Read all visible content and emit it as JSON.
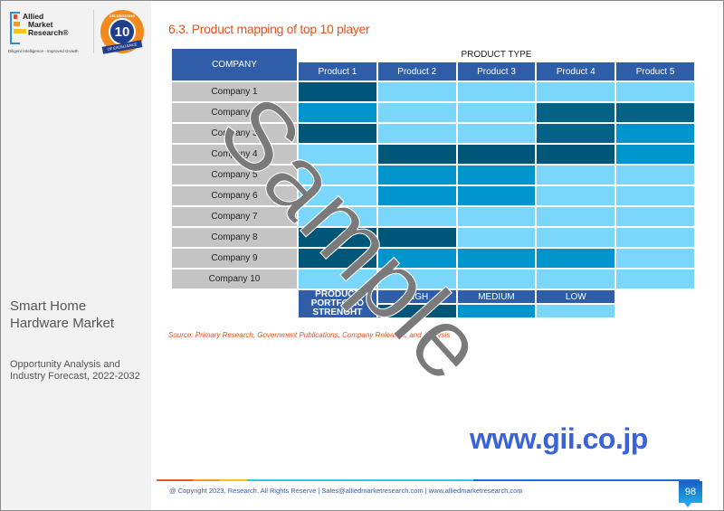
{
  "sidebar": {
    "logo": {
      "line1": "Allied",
      "line2": "Market",
      "line3": "Research®",
      "tagline": "Diligent Intelligence - Improved Growth"
    },
    "badge": {
      "top_text": "CELEBRATING",
      "number": "10",
      "years": "YEARS",
      "ribbon": "OF EXCELLENCE"
    },
    "market_title": "Smart Home Hardware Market",
    "market_subtitle": "Opportunity Analysis and Industry Forecast, 2022-2032"
  },
  "section_title": "6.3. Product mapping of top 10 player",
  "table": {
    "company_header": "COMPANY",
    "product_type_header": "PRODUCT TYPE",
    "products": [
      "Product 1",
      "Product 2",
      "Product 3",
      "Product 4",
      "Product 5"
    ],
    "colors": {
      "high": "#005677",
      "high_alt": "#046287",
      "medium": "#0096cd",
      "low": "#7ad7fb"
    },
    "rows": [
      {
        "company": "Company 1",
        "levels": [
          "high",
          "low",
          "low",
          "low",
          "low"
        ]
      },
      {
        "company": "Company 2",
        "levels": [
          "medium",
          "low",
          "low",
          "high_alt",
          "high_alt"
        ]
      },
      {
        "company": "Company 3",
        "levels": [
          "high",
          "low",
          "low",
          "high_alt",
          "medium"
        ]
      },
      {
        "company": "Company 4",
        "levels": [
          "low",
          "high",
          "high",
          "high",
          "medium"
        ]
      },
      {
        "company": "Company 5",
        "levels": [
          "low",
          "medium",
          "medium",
          "low",
          "low"
        ]
      },
      {
        "company": "Company 6",
        "levels": [
          "low",
          "medium",
          "medium",
          "low",
          "low"
        ]
      },
      {
        "company": "Company 7",
        "levels": [
          "low",
          "low",
          "low",
          "low",
          "low"
        ]
      },
      {
        "company": "Company 8",
        "levels": [
          "high",
          "high",
          "low",
          "low",
          "low"
        ]
      },
      {
        "company": "Company 9",
        "levels": [
          "high",
          "medium",
          "medium",
          "medium",
          "low"
        ]
      },
      {
        "company": "Company 10",
        "levels": [
          "low",
          "low",
          "low",
          "low",
          "low"
        ]
      }
    ],
    "legend": {
      "label": "PRODUCT PORTFOLIO STRENGHT",
      "keys": [
        {
          "label": "HIGH",
          "level": "high"
        },
        {
          "label": "MEDIUM",
          "level": "medium"
        },
        {
          "label": "LOW",
          "level": "low"
        }
      ]
    }
  },
  "source": "Source: Primary Research, Government Publications, Company Releases, and  Analysis",
  "watermark": "Sample",
  "gii_url": "www.gii.co.jp",
  "footer": {
    "text": "@ Copyright 2023, Research. All Rights Reserve | Sales@alliedmarketresearch.com | www.alliedmarketresearch.com",
    "page_number": "98",
    "line_colors": [
      "#e8542b",
      "#f39a25",
      "#f7c417",
      "#36c6e8",
      "#1f6fd0"
    ]
  }
}
